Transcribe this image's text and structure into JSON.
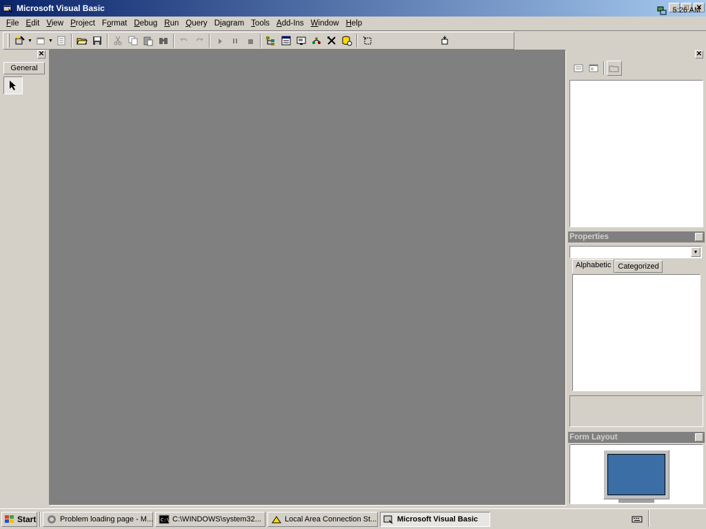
{
  "window": {
    "title": "Microsoft Visual Basic"
  },
  "menu": [
    {
      "label": "File",
      "key": "F",
      "rest": "ile"
    },
    {
      "label": "Edit",
      "key": "E",
      "rest": "dit"
    },
    {
      "label": "View",
      "key": "V",
      "rest": "iew"
    },
    {
      "label": "Project",
      "key": "P",
      "rest": "roject"
    },
    {
      "label": "Format",
      "key": "o",
      "pre": "F",
      "rest": "rmat"
    },
    {
      "label": "Debug",
      "key": "D",
      "rest": "ebug"
    },
    {
      "label": "Run",
      "key": "R",
      "rest": "un"
    },
    {
      "label": "Query",
      "key": "Q",
      "rest": "uery"
    },
    {
      "label": "Diagram",
      "key": "i",
      "pre": "D",
      "rest": "agram"
    },
    {
      "label": "Tools",
      "key": "T",
      "rest": "ools"
    },
    {
      "label": "Add-Ins",
      "key": "A",
      "rest": "dd-Ins"
    },
    {
      "label": "Window",
      "key": "W",
      "rest": "indow"
    },
    {
      "label": "Help",
      "key": "H",
      "rest": "elp"
    }
  ],
  "toolbox": {
    "tab_label": "General",
    "tools": [
      "pointer-icon"
    ]
  },
  "properties": {
    "title": "Properties",
    "tabs": [
      "Alphabetic",
      "Categorized"
    ],
    "selected_tab": "Alphabetic",
    "object_combo": ""
  },
  "form_layout": {
    "title": "Form Layout"
  },
  "taskbar": {
    "start_label": "Start",
    "tasks": [
      {
        "label": "Problem loading page - M...",
        "icon": "firefox-icon",
        "active": false
      },
      {
        "label": "C:\\WINDOWS\\system32...",
        "icon": "console-icon",
        "active": false
      },
      {
        "label": "Local Area Connection St...",
        "icon": "network-icon",
        "active": false
      },
      {
        "label": "Microsoft Visual Basic",
        "icon": "vb-icon",
        "active": true
      }
    ],
    "clock": "5:26 AM"
  }
}
